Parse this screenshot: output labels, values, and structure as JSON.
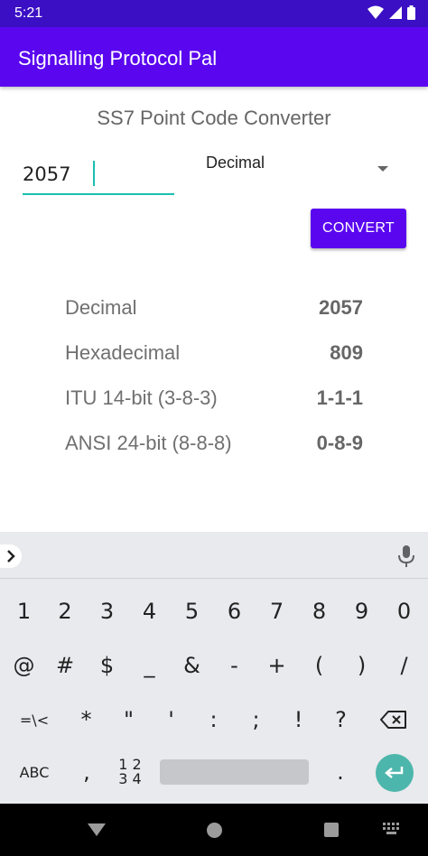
{
  "status_bar": {
    "time": "5:21"
  },
  "app_bar": {
    "title": "Signalling Protocol Pal"
  },
  "converter": {
    "title": "SS7 Point Code Converter",
    "input_value": "2057",
    "format_selected": "Decimal",
    "convert_label": "CONVERT"
  },
  "results": [
    {
      "label": "Decimal",
      "value": "2057"
    },
    {
      "label": "Hexadecimal",
      "value": "809"
    },
    {
      "label": "ITU 14-bit (3-8-3)",
      "value": "1-1-1"
    },
    {
      "label": "ANSI 24-bit (8-8-8)",
      "value": "0-8-9"
    }
  ],
  "keyboard": {
    "row1": [
      "1",
      "2",
      "3",
      "4",
      "5",
      "6",
      "7",
      "8",
      "9",
      "0"
    ],
    "row2": [
      "@",
      "#",
      "$",
      "_",
      "&",
      "-",
      "+",
      "(",
      ")",
      "/"
    ],
    "row3": [
      "=\\<",
      "*",
      "\"",
      "'",
      ":",
      ";",
      "!",
      "?"
    ],
    "row4": {
      "abc": "ABC",
      "comma": ",",
      "numpad_top": "1 2",
      "numpad_bottom": "3 4",
      "period": "."
    }
  },
  "colors": {
    "primary": "#5a07f0",
    "status_bar": "#3b10c4",
    "accent": "#19bfb2",
    "enter_key": "#4db6ac"
  }
}
